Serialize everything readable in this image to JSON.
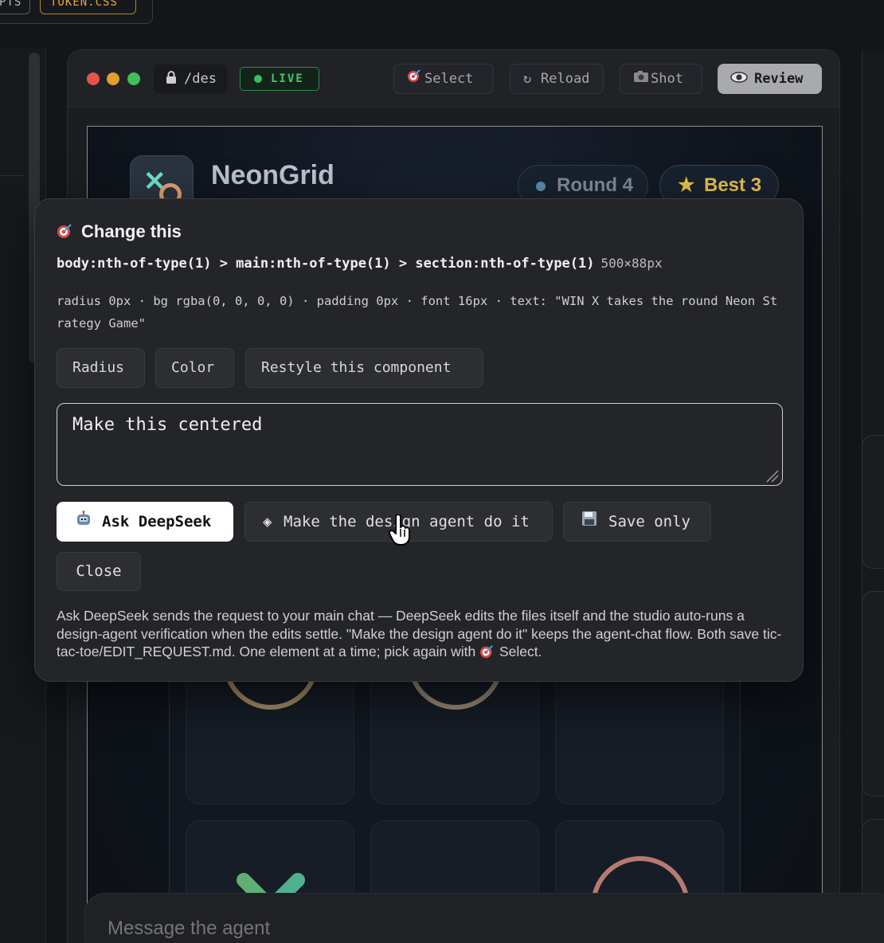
{
  "file_tabs": [
    {
      "label": "PTS",
      "color": "#b9b9b9"
    },
    {
      "label": "TOKEN.CSS",
      "color": "#e6a53a"
    }
  ],
  "browser": {
    "url": "/des",
    "live_label": "LIVE",
    "toolbar": {
      "select_label": "Select",
      "reload_label": "Reload",
      "shot_label": "Shot",
      "review_label": "Review"
    }
  },
  "preview": {
    "brand": "NeonGrid",
    "round_label": "Round 4",
    "best_label": "Best 3"
  },
  "popover": {
    "title": "Change this",
    "selector": "body:nth-of-type(1) > main:nth-of-type(1) > section:nth-of-type(1)",
    "dimensions": "500×88px",
    "properties": "radius 0px · bg rgba(0, 0, 0, 0) · padding 0px · font 16px · text: \"WIN X takes the round Neon Strategy Game\"",
    "chips": [
      "Radius",
      "Color",
      "Restyle this component"
    ],
    "request_text": "Make this centered",
    "ask_label": "Ask DeepSeek",
    "agent_label": "Make the design agent do it",
    "save_label": "Save only",
    "close_label": "Close",
    "help_text": "Ask DeepSeek sends the request to your main chat — DeepSeek edits the files itself and the studio auto-runs a design-agent verification when the edits settle. \"Make the design agent do it\" keeps the agent-chat flow. Both save tic-tac-toe/EDIT_REQUEST.md. One element at a time; pick again with",
    "help_suffix": "Select."
  },
  "message_bar": {
    "placeholder": "Message the agent"
  },
  "colors": {
    "accent_live": "#36c062",
    "traffic_red": "#e5534b",
    "traffic_yellow": "#e0a030",
    "traffic_green": "#3fbf5a",
    "best_gold": "#e8c04a"
  }
}
